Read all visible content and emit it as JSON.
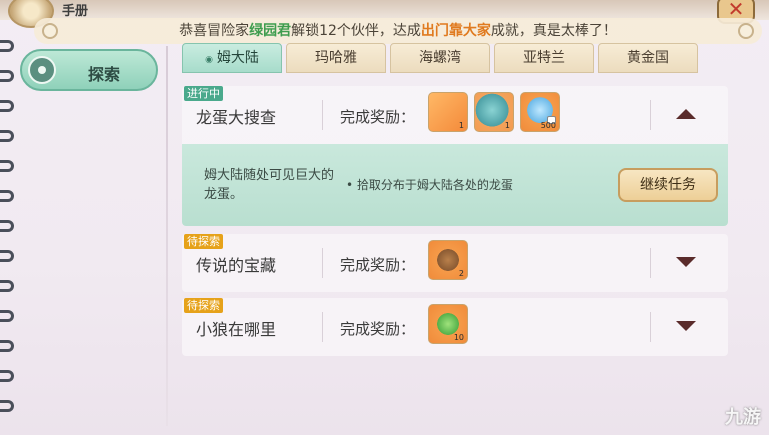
{
  "book_title": "手册",
  "notice": {
    "prefix": "恭喜冒险家",
    "player_name": "绿园君",
    "middle": "解锁12个伙伴，达成",
    "achievement": "出门靠大家",
    "suffix": "成就，真是太棒了！"
  },
  "sidebar": {
    "explore_label": "探索"
  },
  "tabs": [
    "姆大陆",
    "玛哈雅",
    "海螺湾",
    "亚特兰",
    "黄金国"
  ],
  "reward_label": "完成奖励：",
  "quests": [
    {
      "status": "进行中",
      "name": "龙蛋大搜查",
      "rewards": [
        {
          "icon": "orange-scroll-icon",
          "qty": "1"
        },
        {
          "icon": "dragon-egg-icon",
          "qty": "1"
        },
        {
          "icon": "diamond-icon",
          "qty": "500"
        }
      ],
      "description": "姆大陆随处可见巨大的龙蛋。",
      "objective": "• 拾取分布于姆大陆各处的龙蛋",
      "action": "继续任务"
    },
    {
      "status": "待探索",
      "name": "传说的宝藏",
      "rewards": [
        {
          "icon": "wood-icon",
          "qty": "2"
        }
      ]
    },
    {
      "status": "待探索",
      "name": "小狼在哪里",
      "rewards": [
        {
          "icon": "leaf-icon",
          "qty": "10"
        }
      ]
    }
  ],
  "watermark": "九游",
  "colors": {
    "accent": "#8fd1ba",
    "player": "#3f9d4f",
    "achievement": "#e07a1f"
  }
}
